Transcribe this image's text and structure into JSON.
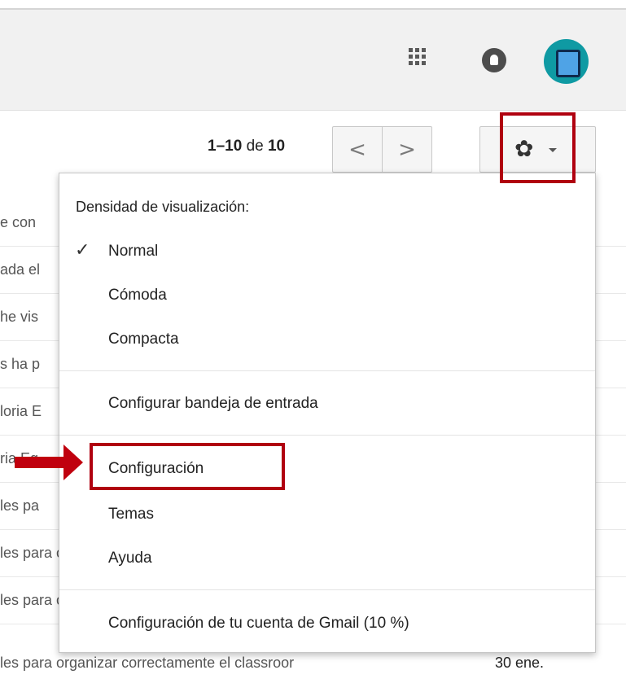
{
  "header": {
    "apps_icon": "apps-grid-icon",
    "notifications_icon": "notifications-bell-icon",
    "avatar_icon": "account-avatar",
    "avatar_color": "#0f9aa3"
  },
  "toolbar": {
    "pager_range": "1–10",
    "pager_of": "de",
    "pager_total": "10",
    "prev_glyph": "<",
    "next_glyph": ">",
    "settings_icon": "gear-icon"
  },
  "mail_list": [
    {
      "snippet": "e con"
    },
    {
      "snippet": "ada el"
    },
    {
      "snippet": "he vis"
    },
    {
      "snippet": "s ha p"
    },
    {
      "snippet": "loria E"
    },
    {
      "snippet": "ria Eg"
    },
    {
      "snippet": "les pa"
    },
    {
      "snippet": "les para organizar correctamente el classroor",
      "date": "30 ene."
    }
  ],
  "settings_menu": {
    "density_heading": "Densidad de visualización:",
    "density_options": [
      {
        "label": "Normal",
        "checked": true
      },
      {
        "label": "Cómoda",
        "checked": false
      },
      {
        "label": "Compacta",
        "checked": false
      }
    ],
    "configure_inbox": "Configurar bandeja de entrada",
    "settings": "Configuración",
    "themes": "Temas",
    "help": "Ayuda",
    "account_storage": "Configuración de tu cuenta de Gmail (10 %)"
  },
  "annotations": {
    "highlight_color": "#b00010",
    "arrow_color": "#c0000e"
  }
}
